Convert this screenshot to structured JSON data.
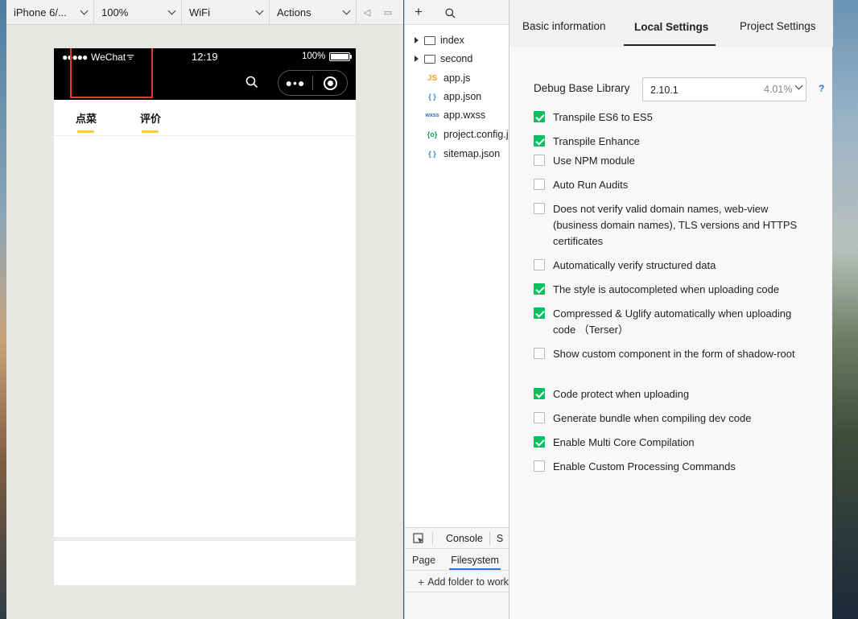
{
  "simulator": {
    "device": "iPhone 6/...",
    "zoom": "100%",
    "network": "WiFi",
    "actions": "Actions",
    "status": {
      "signal": "●●●●●",
      "carrier": "WeChat",
      "time": "12:19",
      "battery": "100%"
    },
    "tabs": [
      "点菜",
      "评价"
    ]
  },
  "files": {
    "items": [
      {
        "name": "index",
        "type": "folder"
      },
      {
        "name": "second",
        "type": "folder"
      },
      {
        "name": "app.js",
        "type": "js",
        "badge": "JS"
      },
      {
        "name": "app.json",
        "type": "json",
        "badge": "{ }"
      },
      {
        "name": "app.wxss",
        "type": "wxss",
        "badge": "wxss"
      },
      {
        "name": "project.config.js",
        "type": "config",
        "badge": "{o}"
      },
      {
        "name": "sitemap.json",
        "type": "json",
        "badge": "{ }"
      }
    ],
    "bottom": {
      "console_tab": "Console",
      "cut_tab": "S",
      "page_tab": "Page",
      "filesystem_tab": "Filesystem",
      "add_folder": "Add folder to work"
    }
  },
  "settings": {
    "tabs": [
      "Basic information",
      "Local Settings",
      "Project Settings"
    ],
    "active_tab": "Local Settings",
    "debug_base_library": {
      "label": "Debug Base Library",
      "value": "2.10.1",
      "percent": "4.01%",
      "help": "?"
    },
    "options": [
      {
        "label": "Transpile ES6 to ES5",
        "checked": true
      },
      {
        "label": "Transpile Enhance",
        "checked": true
      },
      {
        "label": "Use NPM module",
        "checked": false
      },
      {
        "label": "Auto Run Audits",
        "checked": false
      },
      {
        "label": "Does not verify valid domain names, web-view (business domain names), TLS versions and HTTPS certificates",
        "checked": false
      },
      {
        "label": "Automatically verify structured data",
        "checked": false
      },
      {
        "label": "The style is autocompleted when uploading code",
        "checked": true
      },
      {
        "label": "Compressed & Uglify automatically when uploading code （Terser）",
        "checked": true
      },
      {
        "label": "Show custom component in the form of shadow-root",
        "checked": false
      },
      {
        "label": "Code protect when uploading",
        "checked": true
      },
      {
        "label": "Generate bundle when compiling dev code",
        "checked": false
      },
      {
        "label": "Enable Multi Core Compilation",
        "checked": true
      },
      {
        "label": "Enable Custom Processing Commands",
        "checked": false
      }
    ]
  },
  "colors": {
    "accent_green": "#07c160",
    "tab_underline": "#f7c84a",
    "highlight_box": "#e23a30",
    "help_blue": "#2b7bd6"
  }
}
